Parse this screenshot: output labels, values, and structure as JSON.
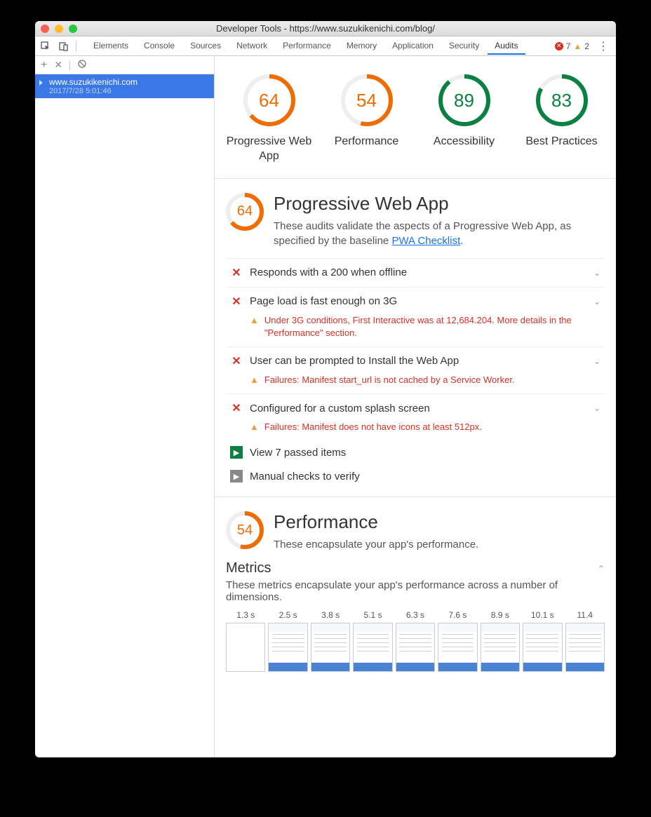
{
  "window": {
    "title": "Developer Tools - https://www.suzukikenichi.com/blog/"
  },
  "devtoolsTabs": [
    "Elements",
    "Console",
    "Sources",
    "Network",
    "Performance",
    "Memory",
    "Application",
    "Security",
    "Audits"
  ],
  "activeTab": "Audits",
  "toolbarStatus": {
    "errors": "7",
    "warnings": "2"
  },
  "sidebar": {
    "audit": {
      "site": "www.suzukikenichi.com",
      "date": "2017/7/28 5:01:46"
    }
  },
  "scores": [
    {
      "label": "Progressive Web App",
      "value": 64,
      "color": "#ef6c00"
    },
    {
      "label": "Performance",
      "value": 54,
      "color": "#ef6c00"
    },
    {
      "label": "Accessibility",
      "value": 89,
      "color": "#0b8043"
    },
    {
      "label": "Best Practices",
      "value": 83,
      "color": "#0b8043"
    }
  ],
  "pwa": {
    "score": 64,
    "color": "#ef6c00",
    "title": "Progressive Web App",
    "desc_pre": "These audits validate the aspects of a Progressive Web App, as specified by the baseline ",
    "link": "PWA Checklist",
    "desc_post": ".",
    "audits": [
      {
        "title": "Responds with a 200 when offline",
        "warning": ""
      },
      {
        "title": "Page load is fast enough on 3G",
        "warning": "Under 3G conditions, First Interactive was at 12,684.204. More details in the \"Performance\" section."
      },
      {
        "title": "User can be prompted to Install the Web App",
        "warning": "Failures: Manifest start_url is not cached by a Service Worker."
      },
      {
        "title": "Configured for a custom splash screen",
        "warning": "Failures: Manifest does not have icons at least 512px."
      }
    ],
    "passed": "View 7 passed items",
    "manual": "Manual checks to verify"
  },
  "perf": {
    "score": 54,
    "color": "#ef6c00",
    "title": "Performance",
    "desc": "These encapsulate your app's performance.",
    "metrics_title": "Metrics",
    "metrics_desc": "These metrics encapsulate your app's performance across a number of dimensions.",
    "filmstrip": [
      "1.3 s",
      "2.5 s",
      "3.8 s",
      "5.1 s",
      "6.3 s",
      "7.6 s",
      "8.9 s",
      "10.1 s",
      "11.4"
    ]
  }
}
